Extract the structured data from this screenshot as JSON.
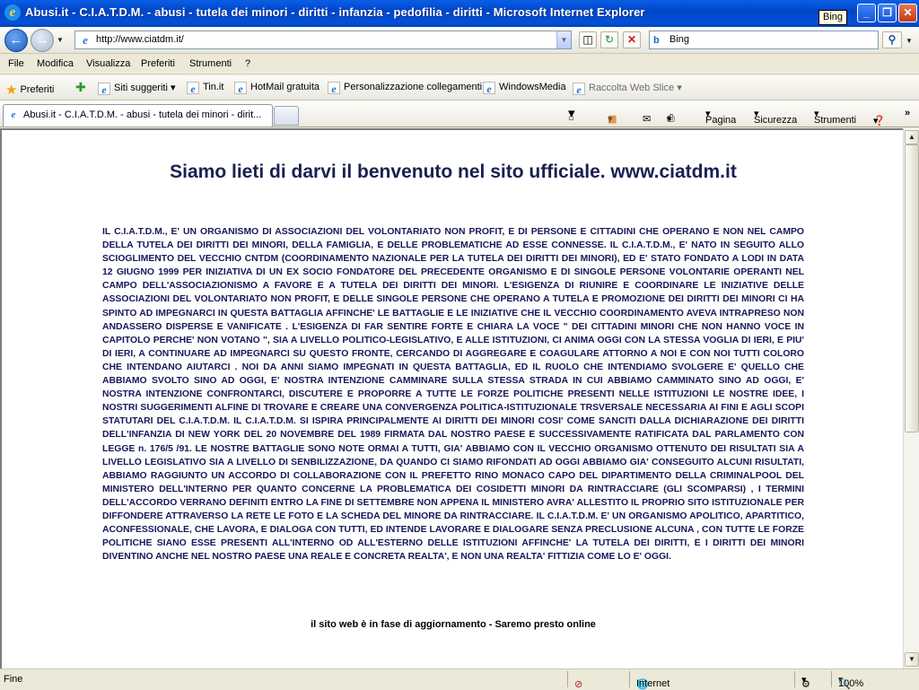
{
  "window": {
    "title": "Abusi.it - C.I.A.T.D.M. - abusi - tutela dei minori - diritti - infanzia - pedofilia - diritti - Microsoft Internet Explorer",
    "tooltip": "Bing",
    "minimize": "_",
    "maximize": "❐",
    "close": "✕"
  },
  "address_bar": {
    "url": "http://www.ciatdm.it/",
    "search_placeholder": "Bing",
    "search_logo": "b"
  },
  "menu": [
    "File",
    "Modifica",
    "Visualizza",
    "Preferiti",
    "Strumenti",
    "?"
  ],
  "favorites_bar": {
    "favorites_label": "Preferiti",
    "items": [
      "Siti suggeriti",
      "Tin.it",
      "HotMail gratuita",
      "Personalizzazione collegamenti",
      "WindowsMedia",
      "Raccolta Web Slice"
    ]
  },
  "tab": {
    "title": "Abusi.it - C.I.A.T.D.M. - abusi - tutela dei minori - dirit..."
  },
  "command_bar": {
    "page": "Pagina",
    "safety": "Sicurezza",
    "tools": "Strumenti"
  },
  "page": {
    "heading": "Siamo lieti di darvi il benvenuto nel sito ufficiale. www.ciatdm.it",
    "body": "IL C.I.A.T.D.M., E' UN ORGANISMO DI ASSOCIAZIONI DEL VOLONTARIATO NON PROFIT, E DI PERSONE E CITTADINI CHE OPERANO E NON NEL CAMPO DELLA TUTELA DEI DIRITTI DEI MINORI, DELLA FAMIGLIA, E DELLE PROBLEMATICHE AD ESSE CONNESSE. IL C.I.A.T.D.M., E' NATO IN SEGUITO ALLO SCIOGLIMENTO DEL VECCHIO CNTDM (COORDINAMENTO NAZIONALE PER LA TUTELA DEI DIRITTI DEI MINORI), ED E' STATO FONDATO A LODI IN DATA 12 GIUGNO 1999 PER INIZIATIVA DI UN EX SOCIO FONDATORE DEL PRECEDENTE ORGANISMO E DI SINGOLE PERSONE VOLONTARIE OPERANTI NEL CAMPO DELL'ASSOCIAZIONISMO A FAVORE E A TUTELA DEI DIRITTI DEI MINORI. L'ESIGENZA DI RIUNIRE E COORDINARE LE INIZIATIVE DELLE ASSOCIAZIONI DEL VOLONTARIATO NON PROFIT, E DELLE SINGOLE PERSONE CHE OPERANO A TUTELA E PROMOZIONE DEI DIRITTI DEI MINORI CI HA SPINTO AD IMPEGNARCI IN QUESTA BATTAGLIA AFFINCHE' LE BATTAGLIE E LE INIZIATIVE CHE IL VECCHIO COORDINAMENTO AVEVA INTRAPRESO NON ANDASSERO DISPERSE E VANIFICATE . L'ESIGENZA DI FAR SENTIRE FORTE E CHIARA LA VOCE \" DEI CITTADINI MINORI CHE NON HANNO VOCE IN CAPITOLO PERCHE' NON VOTANO \", SIA A LIVELLO POLITICO-LEGISLATIVO, E ALLE ISTITUZIONI, CI ANIMA OGGI CON LA STESSA VOGLIA DI IERI, E PIU' DI IERI, A CONTINUARE AD IMPEGNARCI SU QUESTO FRONTE, CERCANDO DI AGGREGARE E COAGULARE ATTORNO A NOI E CON NOI TUTTI COLORO CHE INTENDANO AIUTARCI . NOI DA ANNI SIAMO IMPEGNATI IN QUESTA BATTAGLIA, ED IL RUOLO CHE INTENDIAMO SVOLGERE E' QUELLO CHE ABBIAMO SVOLTO SINO AD OGGI, E' NOSTRA INTENZIONE CAMMINARE SULLA STESSA STRADA IN CUI ABBIAMO CAMMINATO SINO AD OGGI, E' NOSTRA INTENZIONE CONFRONTARCI, DISCUTERE E PROPORRE A TUTTE LE FORZE POLITICHE PRESENTI NELLE ISTITUZIONI LE NOSTRE IDEE, I NOSTRI SUGGERIMENTI ALFINE DI TROVARE E CREARE UNA CONVERGENZA POLITICA-ISTITUZIONALE TRSVERSALE NECESSARIA AI FINI E AGLI SCOPI STATUTARI DEL C.I.A.T.D.M. IL C.I.A.T.D.M. SI ISPIRA PRINCIPALMENTE AI DIRITTI DEI MINORI COSI' COME SANCITI DALLA DICHIARAZIONE DEI DIRITTI DELL'INFANZIA DI NEW YORK DEL 20 NOVEMBRE DEL 1989 FIRMATA DAL NOSTRO PAESE E SUCCESSIVAMENTE RATIFICATA DAL PARLAMENTO CON LEGGE n. 176/5 /91. LE NOSTRE BATTAGLIE SONO NOTE ORMAI A TUTTI, GIA' ABBIAMO CON IL VECCHIO ORGANISMO OTTENUTO DEI RISULTATI SIA A LIVELLO LEGISLATIVO SIA A LIVELLO DI SENBILIZZAZIONE, DA QUANDO CI SIAMO RIFONDATI AD OGGI ABBIAMO GIA' CONSEGUITO ALCUNI RISULTATI, ABBIAMO RAGGIUNTO UN ACCORDO DI COLLABORAZIONE CON IL PREFETTO RINO MONACO CAPO DEL DIPARTIMENTO DELLA CRIMINALPOOL DEL MINISTERO DELL'INTERNO PER QUANTO CONCERNE LA PROBLEMATICA DEI COSIDETTI MINORI DA RINTRACCIARE (GLI SCOMPARSI) , I TERMINI DELL'ACCORDO VERRANO DEFINITI ENTRO LA FINE DI SETTEMBRE NON APPENA IL MINISTERO AVRA' ALLESTITO IL PROPRIO SITO ISTITUZIONALE PER DIFFONDERE ATTRAVERSO LA RETE LE FOTO E LA SCHEDA DEL MINORE DA RINTRACCIARE. IL C.I.A.T.D.M. E' UN ORGANISMO APOLITICO, APARTITICO, ACONFESSIONALE, CHE LAVORA, E DIALOGA CON TUTTI, ED INTENDE LAVORARE E DIALOGARE SENZA PRECLUSIONE ALCUNA , CON TUTTE LE FORZE POLITICHE SIANO ESSE PRESENTI ALL'INTERNO OD ALL'ESTERNO DELLE ISTITUZIONI AFFINCHE' LA TUTELA DEI DIRITTI, E I DIRITTI DEI MINORI DIVENTINO ANCHE NEL NOSTRO PAESE UNA REALE E CONCRETA REALTA', E NON UNA REALTA' FITTIZIA COME LO E' OGGI.",
    "footer_note": "il sito web è in fase di aggiornamento - Saremo presto online"
  },
  "status_bar": {
    "status": "Fine",
    "zone": "Internet",
    "zoom": "100%"
  },
  "icons": {
    "back": "back-arrow-icon",
    "forward": "forward-arrow-icon",
    "favorites": "star-icon",
    "home": "home-icon",
    "feeds": "rss-icon",
    "mail": "mail-icon",
    "print": "printer-icon",
    "help": "help-icon"
  }
}
